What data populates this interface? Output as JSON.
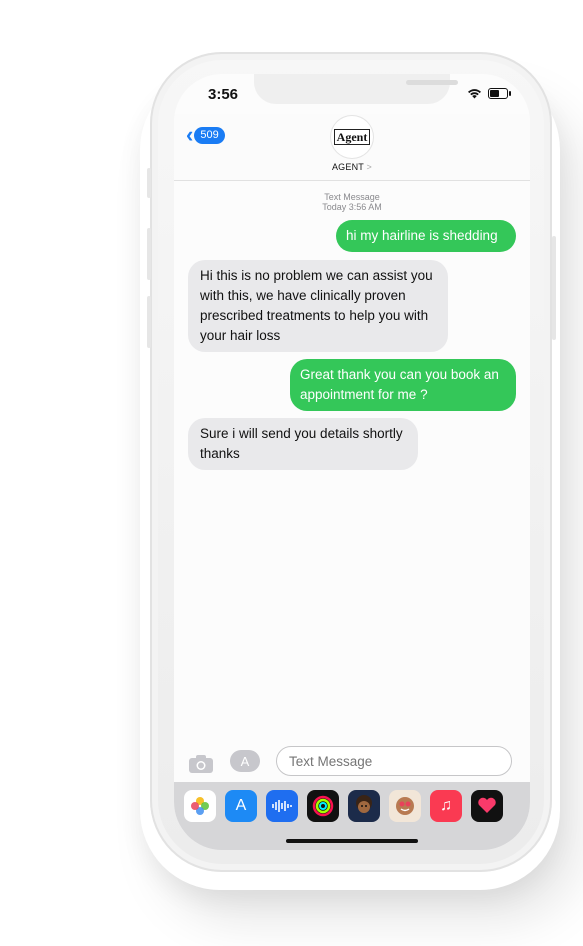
{
  "status_bar": {
    "time": "3:56"
  },
  "header": {
    "back_badge": "509",
    "avatar_text": "Agent",
    "contact_name": "AGENT",
    "contact_chevron": ">"
  },
  "meta": {
    "label": "Text Message",
    "timestamp": "Today 3:56 AM"
  },
  "messages": [
    {
      "from": "me",
      "text": "hi my hairline is shedding"
    },
    {
      "from": "them",
      "text": "Hi this is no problem we can assist you with this, we have clinically proven prescribed treatments to help you with your hair loss"
    },
    {
      "from": "me",
      "text": "Great thank you can you book an appointment for me ?"
    },
    {
      "from": "them",
      "text": "Sure i will send you details shortly thanks"
    }
  ],
  "composer": {
    "placeholder": "Text Message"
  },
  "app_strip": [
    "photos-icon",
    "app-store-icon",
    "audio-message-icon",
    "activity-icon",
    "memoji-icon",
    "animoji-icon",
    "music-icon",
    "digital-touch-icon"
  ],
  "colors": {
    "sent": "#34c759",
    "received": "#e9e9eb",
    "accent": "#1a7cf4"
  }
}
